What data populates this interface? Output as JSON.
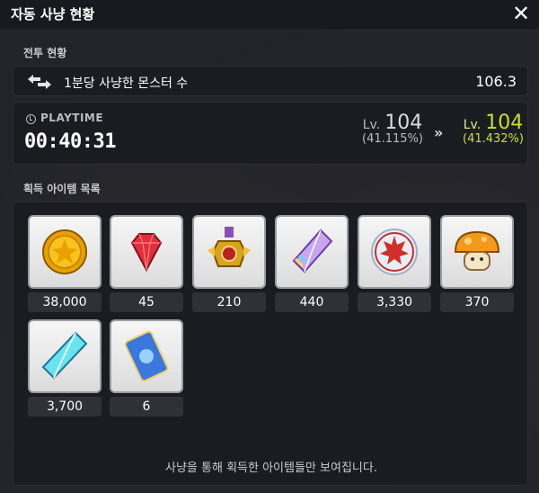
{
  "window": {
    "title": "자동 사냥 현황"
  },
  "combat": {
    "section_label": "전투 현황",
    "kill_label": "1분당 사냥한 몬스터 수",
    "kill_value": "106.3"
  },
  "playtime": {
    "label": "PLAYTIME",
    "time": "00:40:31",
    "level_before": {
      "prefix": "Lv.",
      "level": "104",
      "percent": "(41.115%)"
    },
    "level_after": {
      "prefix": "Lv.",
      "level": "104",
      "percent": "(41.432%)"
    },
    "arrow": "»"
  },
  "items": {
    "section_label": "획득 아이템 목록",
    "list": [
      {
        "icon": "gold-coin-icon",
        "count": "38,000"
      },
      {
        "icon": "red-gem-icon",
        "count": "45"
      },
      {
        "icon": "medal-icon",
        "count": "210"
      },
      {
        "icon": "rainbow-crystal-icon",
        "count": "440"
      },
      {
        "icon": "maple-leaf-icon",
        "count": "3,330"
      },
      {
        "icon": "orange-mushroom-icon",
        "count": "370"
      },
      {
        "icon": "blue-crystal-icon",
        "count": "3,700"
      },
      {
        "icon": "blue-card-icon",
        "count": "6"
      }
    ],
    "footer_note": "사냥을 통해 획득한 아이템들만 보여집니다."
  },
  "colors": {
    "level_up": "#c7e02a",
    "panel": "#1b1c21"
  }
}
